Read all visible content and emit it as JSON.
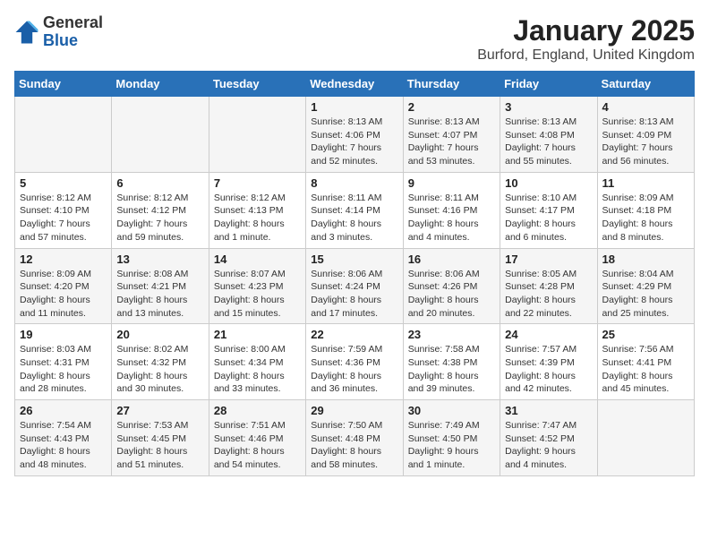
{
  "logo": {
    "general": "General",
    "blue": "Blue"
  },
  "title": "January 2025",
  "subtitle": "Burford, England, United Kingdom",
  "weekdays": [
    "Sunday",
    "Monday",
    "Tuesday",
    "Wednesday",
    "Thursday",
    "Friday",
    "Saturday"
  ],
  "weeks": [
    [
      {
        "day": "",
        "info": ""
      },
      {
        "day": "",
        "info": ""
      },
      {
        "day": "",
        "info": ""
      },
      {
        "day": "1",
        "info": "Sunrise: 8:13 AM\nSunset: 4:06 PM\nDaylight: 7 hours and 52 minutes."
      },
      {
        "day": "2",
        "info": "Sunrise: 8:13 AM\nSunset: 4:07 PM\nDaylight: 7 hours and 53 minutes."
      },
      {
        "day": "3",
        "info": "Sunrise: 8:13 AM\nSunset: 4:08 PM\nDaylight: 7 hours and 55 minutes."
      },
      {
        "day": "4",
        "info": "Sunrise: 8:13 AM\nSunset: 4:09 PM\nDaylight: 7 hours and 56 minutes."
      }
    ],
    [
      {
        "day": "5",
        "info": "Sunrise: 8:12 AM\nSunset: 4:10 PM\nDaylight: 7 hours and 57 minutes."
      },
      {
        "day": "6",
        "info": "Sunrise: 8:12 AM\nSunset: 4:12 PM\nDaylight: 7 hours and 59 minutes."
      },
      {
        "day": "7",
        "info": "Sunrise: 8:12 AM\nSunset: 4:13 PM\nDaylight: 8 hours and 1 minute."
      },
      {
        "day": "8",
        "info": "Sunrise: 8:11 AM\nSunset: 4:14 PM\nDaylight: 8 hours and 3 minutes."
      },
      {
        "day": "9",
        "info": "Sunrise: 8:11 AM\nSunset: 4:16 PM\nDaylight: 8 hours and 4 minutes."
      },
      {
        "day": "10",
        "info": "Sunrise: 8:10 AM\nSunset: 4:17 PM\nDaylight: 8 hours and 6 minutes."
      },
      {
        "day": "11",
        "info": "Sunrise: 8:09 AM\nSunset: 4:18 PM\nDaylight: 8 hours and 8 minutes."
      }
    ],
    [
      {
        "day": "12",
        "info": "Sunrise: 8:09 AM\nSunset: 4:20 PM\nDaylight: 8 hours and 11 minutes."
      },
      {
        "day": "13",
        "info": "Sunrise: 8:08 AM\nSunset: 4:21 PM\nDaylight: 8 hours and 13 minutes."
      },
      {
        "day": "14",
        "info": "Sunrise: 8:07 AM\nSunset: 4:23 PM\nDaylight: 8 hours and 15 minutes."
      },
      {
        "day": "15",
        "info": "Sunrise: 8:06 AM\nSunset: 4:24 PM\nDaylight: 8 hours and 17 minutes."
      },
      {
        "day": "16",
        "info": "Sunrise: 8:06 AM\nSunset: 4:26 PM\nDaylight: 8 hours and 20 minutes."
      },
      {
        "day": "17",
        "info": "Sunrise: 8:05 AM\nSunset: 4:28 PM\nDaylight: 8 hours and 22 minutes."
      },
      {
        "day": "18",
        "info": "Sunrise: 8:04 AM\nSunset: 4:29 PM\nDaylight: 8 hours and 25 minutes."
      }
    ],
    [
      {
        "day": "19",
        "info": "Sunrise: 8:03 AM\nSunset: 4:31 PM\nDaylight: 8 hours and 28 minutes."
      },
      {
        "day": "20",
        "info": "Sunrise: 8:02 AM\nSunset: 4:32 PM\nDaylight: 8 hours and 30 minutes."
      },
      {
        "day": "21",
        "info": "Sunrise: 8:00 AM\nSunset: 4:34 PM\nDaylight: 8 hours and 33 minutes."
      },
      {
        "day": "22",
        "info": "Sunrise: 7:59 AM\nSunset: 4:36 PM\nDaylight: 8 hours and 36 minutes."
      },
      {
        "day": "23",
        "info": "Sunrise: 7:58 AM\nSunset: 4:38 PM\nDaylight: 8 hours and 39 minutes."
      },
      {
        "day": "24",
        "info": "Sunrise: 7:57 AM\nSunset: 4:39 PM\nDaylight: 8 hours and 42 minutes."
      },
      {
        "day": "25",
        "info": "Sunrise: 7:56 AM\nSunset: 4:41 PM\nDaylight: 8 hours and 45 minutes."
      }
    ],
    [
      {
        "day": "26",
        "info": "Sunrise: 7:54 AM\nSunset: 4:43 PM\nDaylight: 8 hours and 48 minutes."
      },
      {
        "day": "27",
        "info": "Sunrise: 7:53 AM\nSunset: 4:45 PM\nDaylight: 8 hours and 51 minutes."
      },
      {
        "day": "28",
        "info": "Sunrise: 7:51 AM\nSunset: 4:46 PM\nDaylight: 8 hours and 54 minutes."
      },
      {
        "day": "29",
        "info": "Sunrise: 7:50 AM\nSunset: 4:48 PM\nDaylight: 8 hours and 58 minutes."
      },
      {
        "day": "30",
        "info": "Sunrise: 7:49 AM\nSunset: 4:50 PM\nDaylight: 9 hours and 1 minute."
      },
      {
        "day": "31",
        "info": "Sunrise: 7:47 AM\nSunset: 4:52 PM\nDaylight: 9 hours and 4 minutes."
      },
      {
        "day": "",
        "info": ""
      }
    ]
  ]
}
